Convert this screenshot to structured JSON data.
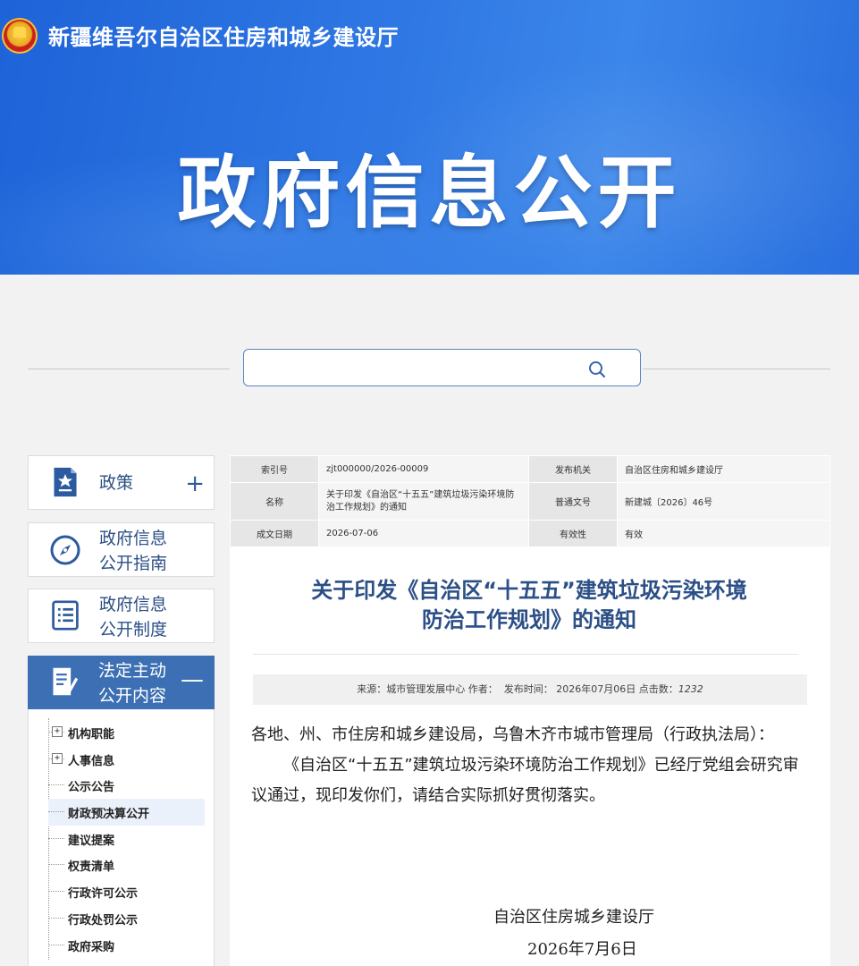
{
  "header": {
    "site_title": "新疆维吾尔自治区住房和城乡建设厅",
    "hero_title": "政府信息公开",
    "emblem": "national-emblem"
  },
  "search": {
    "placeholder": "",
    "icon": "search-icon"
  },
  "sidebar": {
    "items": [
      {
        "label": "政策",
        "icon": "policy-doc-icon",
        "toggle": "+"
      },
      {
        "label_line1": "政府信息",
        "label_line2": "公开指南",
        "icon": "compass-icon"
      },
      {
        "label_line1": "政府信息",
        "label_line2": "公开制度",
        "icon": "list-doc-icon"
      },
      {
        "label_line1": "法定主动",
        "label_line2": "公开内容",
        "icon": "edit-doc-icon",
        "toggle": "—"
      }
    ],
    "tree": [
      {
        "label": "机构职能",
        "expand": "+"
      },
      {
        "label": "人事信息",
        "expand": "+"
      },
      {
        "label": "公示公告"
      },
      {
        "label": "财政预决算公开"
      },
      {
        "label": "建议提案"
      },
      {
        "label": "权责清单"
      },
      {
        "label": "行政许可公示"
      },
      {
        "label": "行政处罚公示"
      },
      {
        "label": "政府采购"
      }
    ]
  },
  "meta": {
    "index_key": "索引号",
    "index_val": "zjt000000/2026-00009",
    "org_key": "发布机关",
    "org_val": "自治区住房和城乡建设厅",
    "name_key": "名称",
    "name_val": "关于印发《自治区“十五五”建筑垃圾污染环境防治工作规划》的通知",
    "docno_key": "普通文号",
    "docno_val": "新建城〔2026〕46号",
    "date_key": "成文日期",
    "date_val": "2026-07-06",
    "valid_key": "有效性",
    "valid_val": "有效"
  },
  "article": {
    "title_line1": "关于印发《自治区“十五五”建筑垃圾污染环境",
    "title_line2": "防治工作规划》的通知",
    "source_label": "来源：",
    "source": "城市管理发展中心",
    "author_label": "作者：",
    "pub_label": "发布时间：",
    "pub_date": "2026年07月06日",
    "hits_label": "点击数：",
    "hits": "1232",
    "salutation": "各地、州、市住房和城乡建设局，乌鲁木齐市城市管理局（行政执法局）：",
    "body": "《自治区“十五五”建筑垃圾污染环境防治工作规划》已经厅党组会研究审议通过，现印发你们，请结合实际抓好贯彻落实。",
    "sign_org": "自治区住房城乡建设厅",
    "sign_date": "2026年7月6日"
  },
  "colors": {
    "banner_blue": "#2f78e4",
    "sidebar_active": "#3c6fb3",
    "title_blue": "#2b4f86"
  }
}
